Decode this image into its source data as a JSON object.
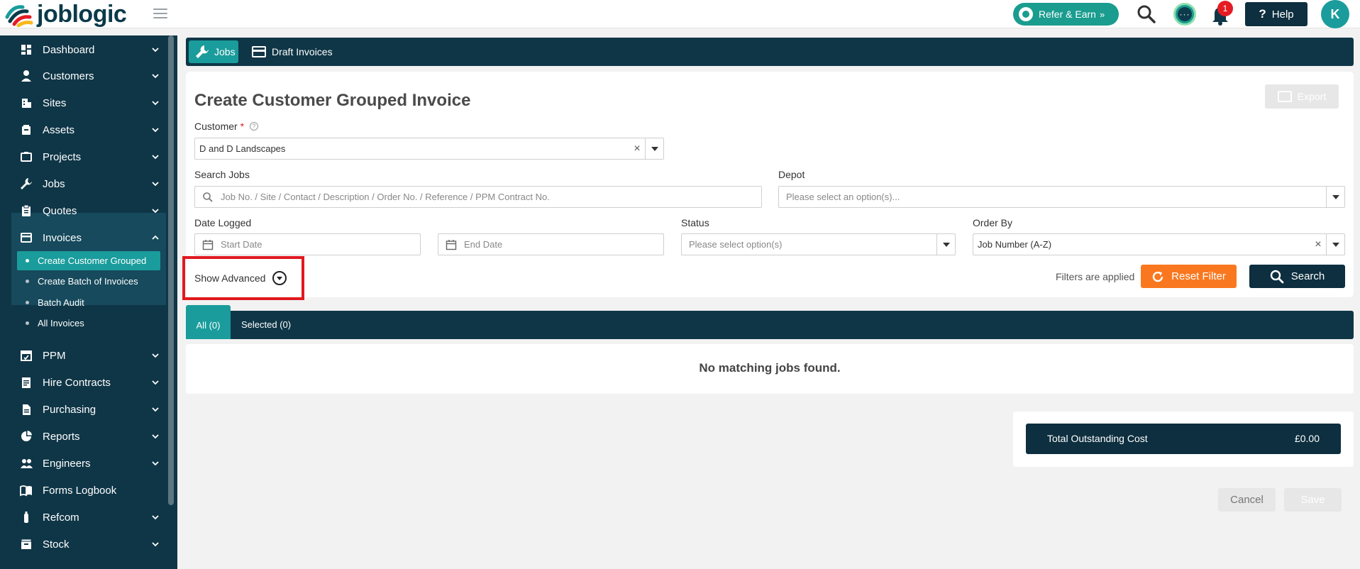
{
  "header": {
    "logo_text": "joblogic",
    "refer_label": "Refer & Earn",
    "notification_count": "1",
    "help_label": "Help",
    "avatar_initial": "K"
  },
  "sidebar": {
    "items": [
      {
        "label": "Dashboard",
        "icon": "dashboard-icon"
      },
      {
        "label": "Customers",
        "icon": "person-icon"
      },
      {
        "label": "Sites",
        "icon": "building-icon"
      },
      {
        "label": "Assets",
        "icon": "box-icon"
      },
      {
        "label": "Projects",
        "icon": "projects-icon"
      },
      {
        "label": "Jobs",
        "icon": "wrench-icon"
      },
      {
        "label": "Quotes",
        "icon": "clipboard-icon"
      },
      {
        "label": "Invoices",
        "icon": "invoice-icon"
      },
      {
        "label": "PPM",
        "icon": "calendar-icon"
      },
      {
        "label": "Hire Contracts",
        "icon": "contract-icon"
      },
      {
        "label": "Purchasing",
        "icon": "document-icon"
      },
      {
        "label": "Reports",
        "icon": "pie-chart-icon"
      },
      {
        "label": "Engineers",
        "icon": "group-icon"
      },
      {
        "label": "Forms Logbook",
        "icon": "book-icon"
      },
      {
        "label": "Refcom",
        "icon": "cylinder-icon"
      },
      {
        "label": "Stock",
        "icon": "stock-icon"
      }
    ],
    "invoice_sub": [
      {
        "label": "Create Customer Grouped"
      },
      {
        "label": "Create Batch of Invoices"
      },
      {
        "label": "Batch Audit"
      },
      {
        "label": "All Invoices"
      }
    ]
  },
  "tabs": {
    "jobs": "Jobs",
    "draft_invoices": "Draft Invoices"
  },
  "form": {
    "title": "Create Customer Grouped Invoice",
    "export_label": "Export",
    "customer_label": "Customer",
    "customer_value": "D and D Landscapes",
    "search_jobs_label": "Search Jobs",
    "search_jobs_placeholder": "Job No. / Site / Contact / Description / Order No. / Reference / PPM Contract No.",
    "depot_label": "Depot",
    "depot_placeholder": "Please select an option(s)...",
    "date_logged_label": "Date Logged",
    "start_date_placeholder": "Start Date",
    "end_date_placeholder": "End Date",
    "status_label": "Status",
    "status_placeholder": "Please select option(s)",
    "order_by_label": "Order By",
    "order_by_value": "Job Number (A-Z)",
    "show_advanced": "Show Advanced",
    "filters_applied": "Filters are applied",
    "reset_filter": "Reset Filter",
    "search": "Search"
  },
  "results": {
    "tab_all": "All (0)",
    "tab_selected": "Selected (0)",
    "empty_message": "No matching jobs found."
  },
  "totals": {
    "label": "Total Outstanding Cost",
    "amount": "£0.00"
  },
  "footer": {
    "cancel": "Cancel",
    "save": "Save"
  },
  "colors": {
    "navy": "#0f3647",
    "teal": "#1a9c9c",
    "orange": "#f9781f",
    "highlight_red": "#e0191f"
  }
}
